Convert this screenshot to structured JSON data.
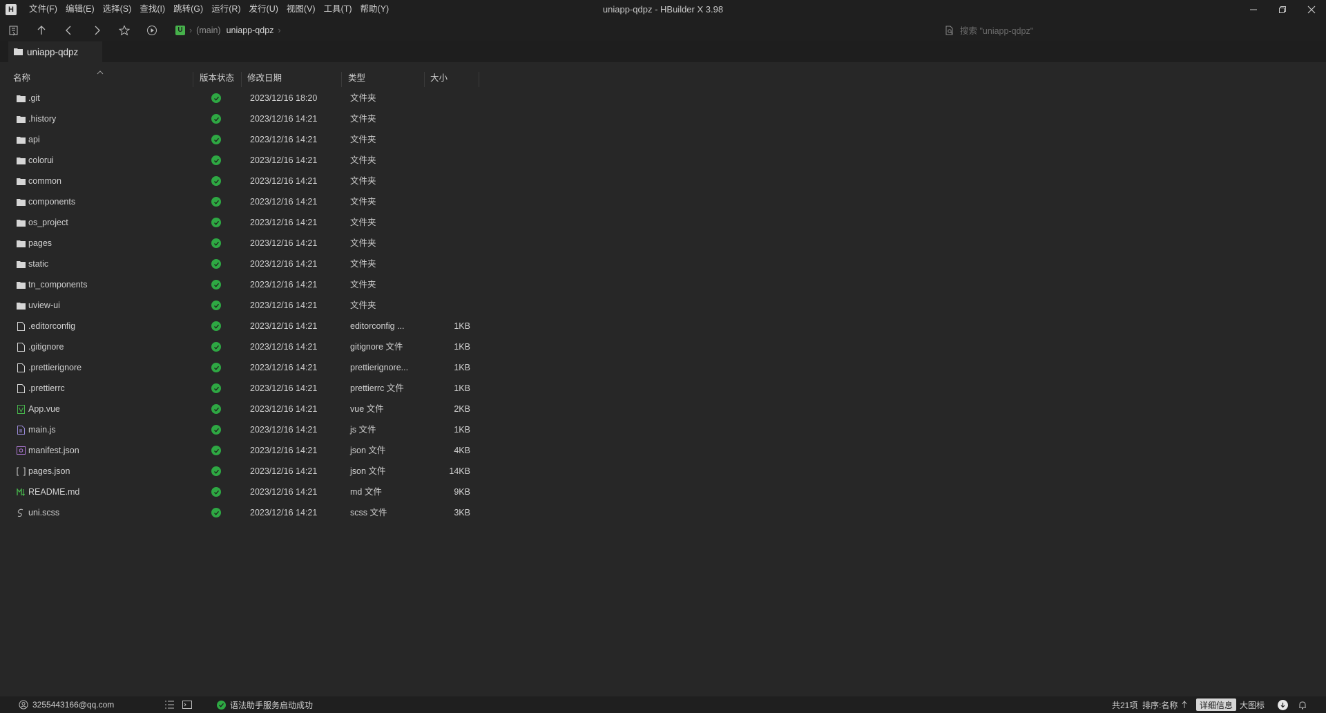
{
  "app": {
    "logo_letter": "H",
    "window_title": "uniapp-qdpz - HBuilder X 3.98"
  },
  "menu": [
    {
      "label": "文件(F)"
    },
    {
      "label": "编辑(E)"
    },
    {
      "label": "选择(S)"
    },
    {
      "label": "查找(I)"
    },
    {
      "label": "跳转(G)"
    },
    {
      "label": "运行(R)"
    },
    {
      "label": "发行(U)"
    },
    {
      "label": "视图(V)"
    },
    {
      "label": "工具(T)"
    },
    {
      "label": "帮助(Y)"
    }
  ],
  "toolbar": {
    "project_badge": "U",
    "branch": "(main)",
    "project_name": "uniapp-qdpz",
    "search_placeholder": "搜索 \"uniapp-qdpz\""
  },
  "tab": {
    "label": "uniapp-qdpz"
  },
  "columns": {
    "name": "名称",
    "vcs_status": "版本状态",
    "modified": "修改日期",
    "type": "类型",
    "size": "大小"
  },
  "files": [
    {
      "name": ".git",
      "date": "2023/12/16 18:20",
      "type": "文件夹",
      "size": "",
      "icon": "folder-icon"
    },
    {
      "name": ".history",
      "date": "2023/12/16 14:21",
      "type": "文件夹",
      "size": "",
      "icon": "folder-icon"
    },
    {
      "name": "api",
      "date": "2023/12/16 14:21",
      "type": "文件夹",
      "size": "",
      "icon": "folder-icon"
    },
    {
      "name": "colorui",
      "date": "2023/12/16 14:21",
      "type": "文件夹",
      "size": "",
      "icon": "folder-icon"
    },
    {
      "name": "common",
      "date": "2023/12/16 14:21",
      "type": "文件夹",
      "size": "",
      "icon": "folder-icon"
    },
    {
      "name": "components",
      "date": "2023/12/16 14:21",
      "type": "文件夹",
      "size": "",
      "icon": "folder-icon"
    },
    {
      "name": "os_project",
      "date": "2023/12/16 14:21",
      "type": "文件夹",
      "size": "",
      "icon": "folder-icon"
    },
    {
      "name": "pages",
      "date": "2023/12/16 14:21",
      "type": "文件夹",
      "size": "",
      "icon": "folder-icon"
    },
    {
      "name": "static",
      "date": "2023/12/16 14:21",
      "type": "文件夹",
      "size": "",
      "icon": "folder-icon"
    },
    {
      "name": "tn_components",
      "date": "2023/12/16 14:21",
      "type": "文件夹",
      "size": "",
      "icon": "folder-icon"
    },
    {
      "name": "uview-ui",
      "date": "2023/12/16 14:21",
      "type": "文件夹",
      "size": "",
      "icon": "folder-icon"
    },
    {
      "name": ".editorconfig",
      "date": "2023/12/16 14:21",
      "type": "editorconfig ...",
      "size": "1KB",
      "icon": "file-icon"
    },
    {
      "name": ".gitignore",
      "date": "2023/12/16 14:21",
      "type": "gitignore 文件",
      "size": "1KB",
      "icon": "file-icon"
    },
    {
      "name": ".prettierignore",
      "date": "2023/12/16 14:21",
      "type": "prettierignore...",
      "size": "1KB",
      "icon": "file-icon"
    },
    {
      "name": ".prettierrc",
      "date": "2023/12/16 14:21",
      "type": "prettierrc 文件",
      "size": "1KB",
      "icon": "file-icon"
    },
    {
      "name": "App.vue",
      "date": "2023/12/16 14:21",
      "type": "vue 文件",
      "size": "2KB",
      "icon": "vue-file-icon"
    },
    {
      "name": "main.js",
      "date": "2023/12/16 14:21",
      "type": "js 文件",
      "size": "1KB",
      "icon": "js-file-icon"
    },
    {
      "name": "manifest.json",
      "date": "2023/12/16 14:21",
      "type": "json 文件",
      "size": "4KB",
      "icon": "manifest-file-icon"
    },
    {
      "name": "pages.json",
      "date": "2023/12/16 14:21",
      "type": "json 文件",
      "size": "14KB",
      "icon": "json-file-icon"
    },
    {
      "name": "README.md",
      "date": "2023/12/16 14:21",
      "type": "md 文件",
      "size": "9KB",
      "icon": "markdown-file-icon"
    },
    {
      "name": "uni.scss",
      "date": "2023/12/16 14:21",
      "type": "scss 文件",
      "size": "3KB",
      "icon": "scss-file-icon"
    }
  ],
  "statusbar": {
    "account": "3255443166@qq.com",
    "service_message": "语法助手服务启动成功",
    "item_count": "共21项",
    "sort_label": "排序:名称",
    "view_detail": "详细信息",
    "view_large": "大图标"
  },
  "colors": {
    "ok_green": "#2ea843",
    "background": "#272727",
    "chrome": "#1f1f1f"
  }
}
